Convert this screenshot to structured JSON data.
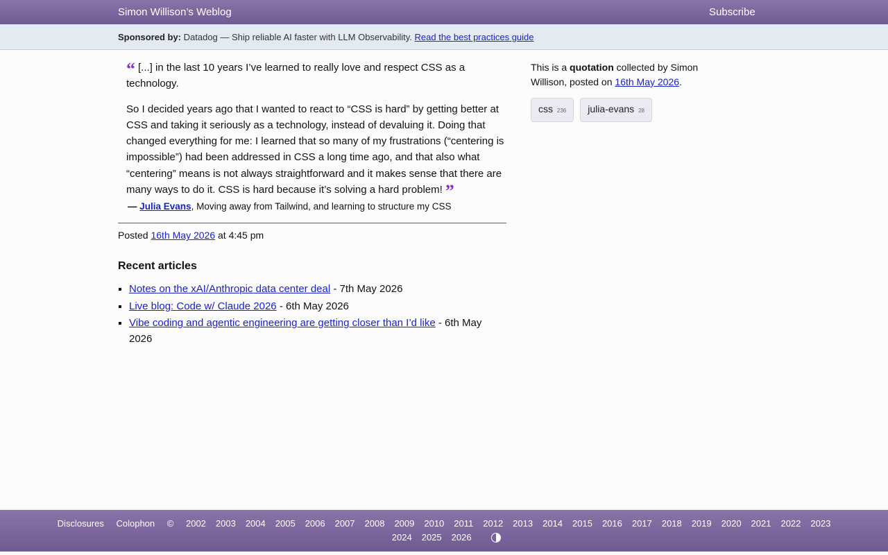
{
  "header": {
    "site_title": "Simon Willison’s Weblog",
    "subscribe": "Subscribe"
  },
  "sponsor": {
    "label": "Sponsored by:",
    "text": "Datadog — Ship reliable AI faster with LLM Observability.",
    "link": "Read the best practices guide"
  },
  "quote": {
    "open_mark": "“",
    "close_mark": "”",
    "p1": "[...] in the last 10 years I’ve learned to really love and respect CSS as a technology.",
    "p2": "So I decided years ago that I wanted to react to “CSS is hard” by getting better at CSS and taking it seriously as a technology, instead of devaluing it. Doing that changed everything for me: I learned that so many of my frustrations (“centering is impossible”) had been addressed in CSS a long time ago, and that also what “centering” means is not always straightforward and it makes sense that there are many ways to do it. CSS is hard because it’s solving a hard problem!",
    "dash": "—",
    "author": "Julia Evans",
    "source": "Moving away from Tailwind, and learning to structure my CSS"
  },
  "posted": {
    "prefix": "Posted",
    "date": "16th May 2026",
    "time": "at 4:45 pm"
  },
  "recent": {
    "heading": "Recent articles",
    "items": [
      {
        "title": "Notes on the xAI/Anthropic data center deal",
        "date": "- 7th May 2026"
      },
      {
        "title": "Live blog: Code w/ Claude 2026",
        "date": "- 6th May 2026"
      },
      {
        "title": "Vibe coding and agentic engineering are getting closer than I’d like",
        "date": "- 6th May 2026"
      }
    ]
  },
  "sidebar": {
    "text1": "This is a",
    "kind": "quotation",
    "text2": "collected by Simon Willison, posted on",
    "date": "16th May 2026",
    "tags": [
      {
        "name": "css",
        "count": "236"
      },
      {
        "name": "julia-evans",
        "count": "28"
      }
    ]
  },
  "footer": {
    "disclosures": "Disclosures",
    "colophon": "Colophon",
    "copyright": "©",
    "years_row1": [
      "2002",
      "2003",
      "2004",
      "2005",
      "2006",
      "2007",
      "2008",
      "2009",
      "2010",
      "2011",
      "2012",
      "2013",
      "2014",
      "2015",
      "2016",
      "2017",
      "2018",
      "2019",
      "2020",
      "2021",
      "2022",
      "2023"
    ],
    "years_row2": [
      "2024",
      "2025",
      "2026"
    ],
    "contrast_icon": "contrast-icon"
  }
}
